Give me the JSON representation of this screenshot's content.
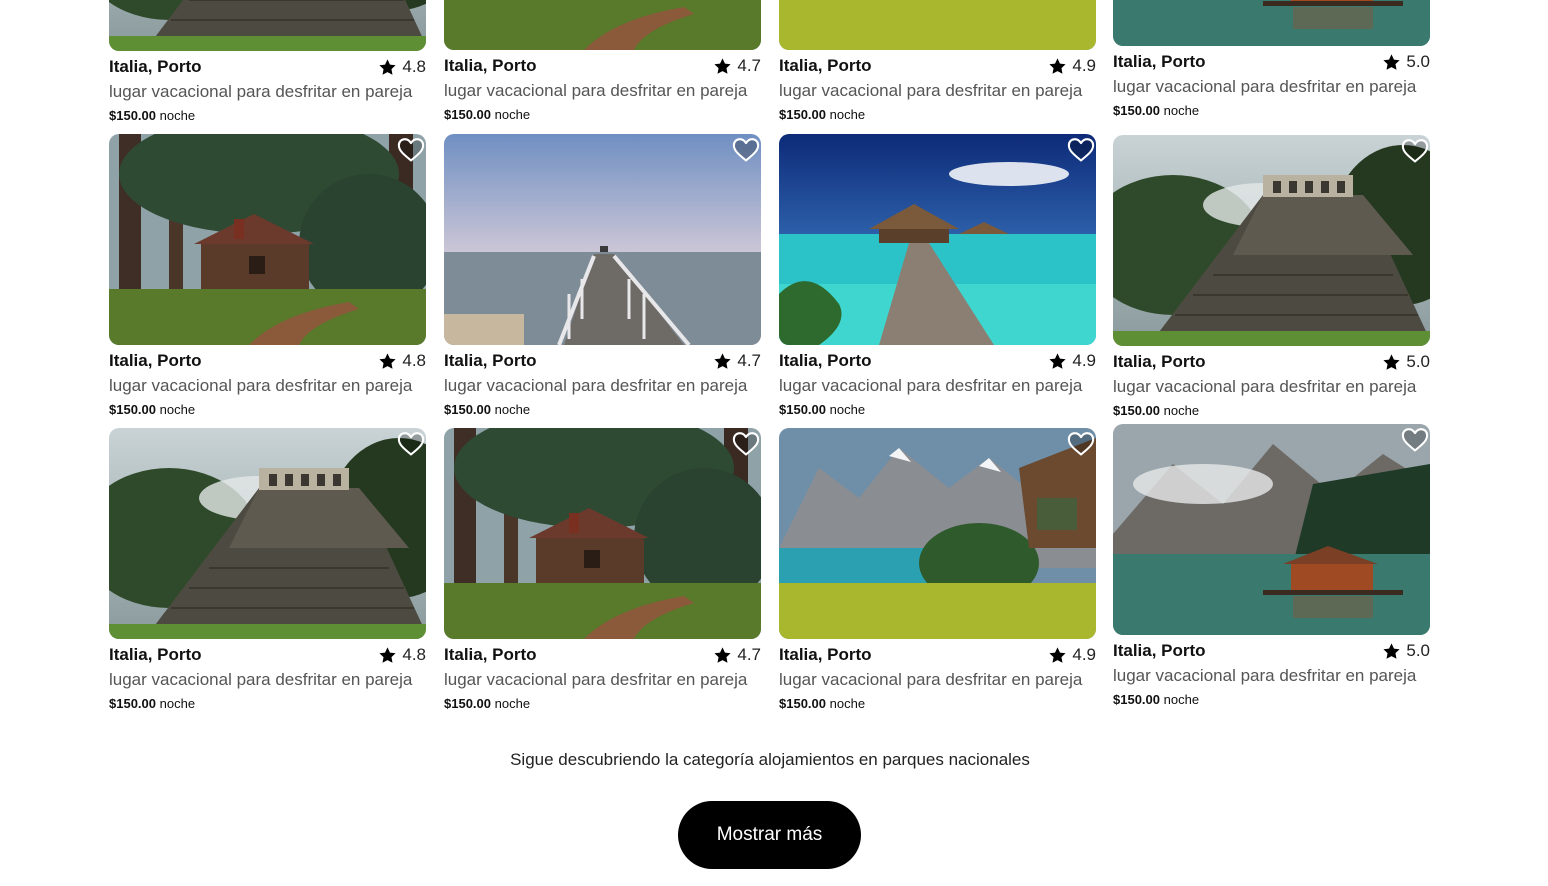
{
  "listings": [
    {
      "location": "Italia, Porto",
      "rating": "4.8",
      "description": "lugar vacacional para desfritar en pareja",
      "price": "$150.00",
      "unit": "noche",
      "scene": "pyramid-icon"
    },
    {
      "location": "Italia, Porto",
      "rating": "4.7",
      "description": "lugar vacacional para desfritar en pareja",
      "price": "$150.00",
      "unit": "noche",
      "scene": "forest-cabin-icon"
    },
    {
      "location": "Italia, Porto",
      "rating": "4.9",
      "description": "lugar vacacional para desfritar en pareja",
      "price": "$150.00",
      "unit": "noche",
      "scene": "mountain-lake-icon"
    },
    {
      "location": "Italia, Porto",
      "rating": "5.0",
      "description": "lugar vacacional para desfritar en pareja",
      "price": "$150.00",
      "unit": "noche",
      "scene": "lake-house-icon"
    },
    {
      "location": "Italia, Porto",
      "rating": "4.8",
      "description": "lugar vacacional para desfritar en pareja",
      "price": "$150.00",
      "unit": "noche",
      "scene": "forest-cabin-icon"
    },
    {
      "location": "Italia, Porto",
      "rating": "4.7",
      "description": "lugar vacacional para desfritar en pareja",
      "price": "$150.00",
      "unit": "noche",
      "scene": "pier-icon"
    },
    {
      "location": "Italia, Porto",
      "rating": "4.9",
      "description": "lugar vacacional para desfritar en pareja",
      "price": "$150.00",
      "unit": "noche",
      "scene": "tropical-bungalow-icon"
    },
    {
      "location": "Italia, Porto",
      "rating": "5.0",
      "description": "lugar vacacional para desfritar en pareja",
      "price": "$150.00",
      "unit": "noche",
      "scene": "pyramid-icon"
    },
    {
      "location": "Italia, Porto",
      "rating": "4.8",
      "description": "lugar vacacional para desfritar en pareja",
      "price": "$150.00",
      "unit": "noche",
      "scene": "pyramid-icon"
    },
    {
      "location": "Italia, Porto",
      "rating": "4.7",
      "description": "lugar vacacional para desfritar en pareja",
      "price": "$150.00",
      "unit": "noche",
      "scene": "forest-cabin-icon"
    },
    {
      "location": "Italia, Porto",
      "rating": "4.9",
      "description": "lugar vacacional para desfritar en pareja",
      "price": "$150.00",
      "unit": "noche",
      "scene": "mountain-lake-icon"
    },
    {
      "location": "Italia, Porto",
      "rating": "5.0",
      "description": "lugar vacacional para desfritar en pareja",
      "price": "$150.00",
      "unit": "noche",
      "scene": "lake-house-icon"
    }
  ],
  "footer": {
    "discover_text": "Sigue descubriendo la categoría alojamientos en parques nacionales",
    "more_button": "Mostrar más"
  },
  "icons": {
    "favorite": "heart-icon",
    "rating": "star-icon"
  },
  "colors": {
    "button_bg": "#000000",
    "button_text": "#ffffff"
  }
}
